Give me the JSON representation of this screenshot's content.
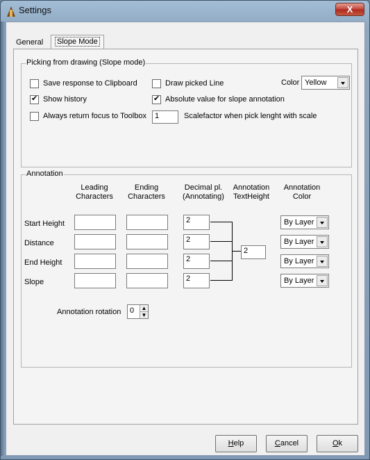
{
  "window": {
    "title": "Settings",
    "close_label": "X"
  },
  "tabs": [
    {
      "label": "General"
    },
    {
      "label": "Slope Mode"
    }
  ],
  "picking": {
    "title": "Picking from drawing (Slope mode)",
    "save_clipboard": {
      "label": "Save response to Clipboard",
      "checked": false
    },
    "draw_line": {
      "label": "Draw picked Line",
      "checked": false
    },
    "color_label": "Color",
    "color_value": "Yellow",
    "show_history": {
      "label": "Show history",
      "checked": true
    },
    "absolute_value": {
      "label": "Absolute value for slope annotation",
      "checked": true
    },
    "return_focus": {
      "label": "Always return focus to Toolbox",
      "checked": false
    },
    "scalefactor_value": "1",
    "scalefactor_label": "Scalefactor when pick lenght with scale"
  },
  "annotation": {
    "title": "Annotation",
    "headers": {
      "leading": "Leading\nCharacters",
      "ending": "Ending\nCharacters",
      "decimal": "Decimal pl.\n(Annotating)",
      "text_height": "Annotation\nTextHeight",
      "color": "Annotation\nColor"
    },
    "rows": [
      {
        "label": "Start Height",
        "leading": "",
        "ending": "",
        "decimal": "2",
        "color": "By Layer"
      },
      {
        "label": "Distance",
        "leading": "",
        "ending": "",
        "decimal": "2",
        "color": "By Layer"
      },
      {
        "label": "End Height",
        "leading": "",
        "ending": "",
        "decimal": "2",
        "color": "By Layer"
      },
      {
        "label": "Slope",
        "leading": "",
        "ending": "",
        "decimal": "2",
        "color": "By Layer"
      }
    ],
    "text_height_value": "2",
    "rotation_label": "Annotation rotation",
    "rotation_value": "0"
  },
  "buttons": {
    "help_prefix": "H",
    "help_rest": "elp",
    "cancel_prefix": "C",
    "cancel_rest": "ancel",
    "ok_prefix": "O",
    "ok_rest": "k"
  }
}
